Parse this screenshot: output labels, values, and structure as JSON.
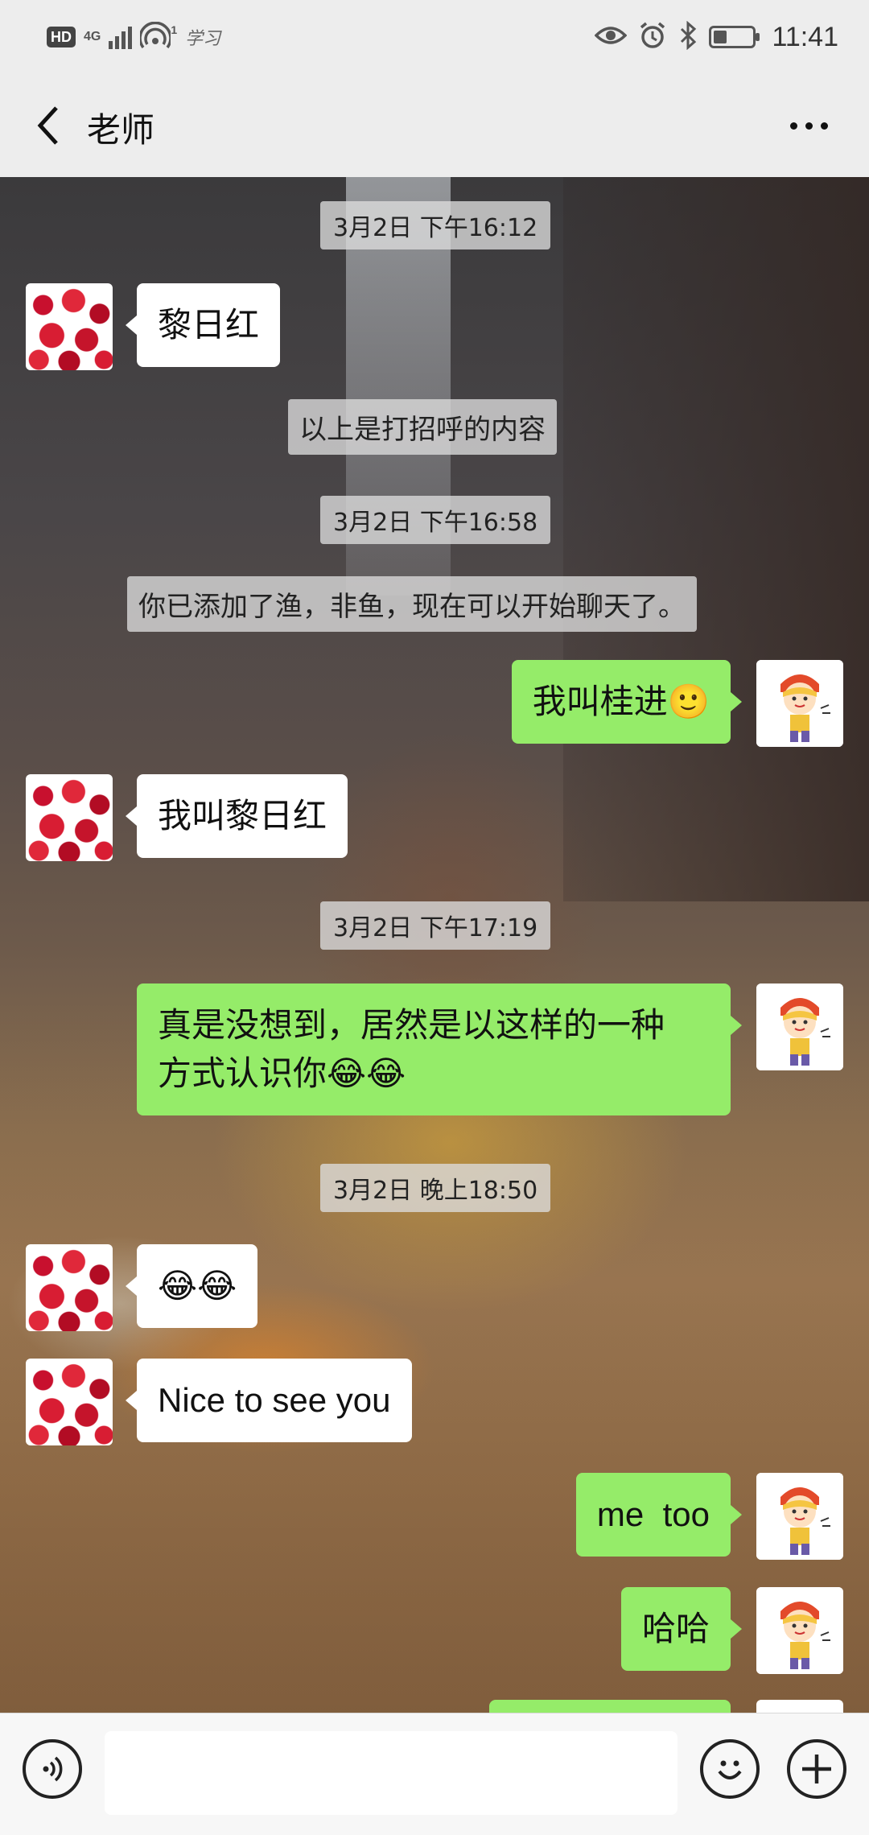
{
  "status_bar": {
    "hd": "HD",
    "network": "4G",
    "hotspot_count": "1",
    "app_text": "学习",
    "time": "11:41",
    "battery_level": 0.35
  },
  "header": {
    "title": "老师"
  },
  "messages": {
    "t1": "3月2日 下午16:12",
    "m1": "黎日红",
    "s1": "以上是打招呼的内容",
    "t2": "3月2日 下午16:58",
    "s2": "你已添加了渔，非鱼，现在可以开始聊天了。",
    "m2": "我叫桂进",
    "m2_emoji": "🙂",
    "m3": "我叫黎日红",
    "t3": "3月2日 下午17:19",
    "m4_line1": "真是没想到，居然是以这样的一种",
    "m4_line2": "方式认识你",
    "m4_emoji": "😂😂",
    "t4": "3月2日 晚上18:50",
    "m5_emoji": "😂😂",
    "m6": "Nice to see you",
    "m7": "me  too",
    "m8": "哈哈"
  },
  "input_bar": {
    "placeholder": ""
  },
  "colors": {
    "outgoing_bubble": "#95ec69",
    "incoming_bubble": "#ffffff",
    "bar_bg": "#ededed"
  },
  "icons": {
    "back": "chevron-left-icon",
    "more": "more-dots-icon",
    "voice": "voice-icon",
    "emoji": "smiley-icon",
    "plus": "plus-icon"
  }
}
